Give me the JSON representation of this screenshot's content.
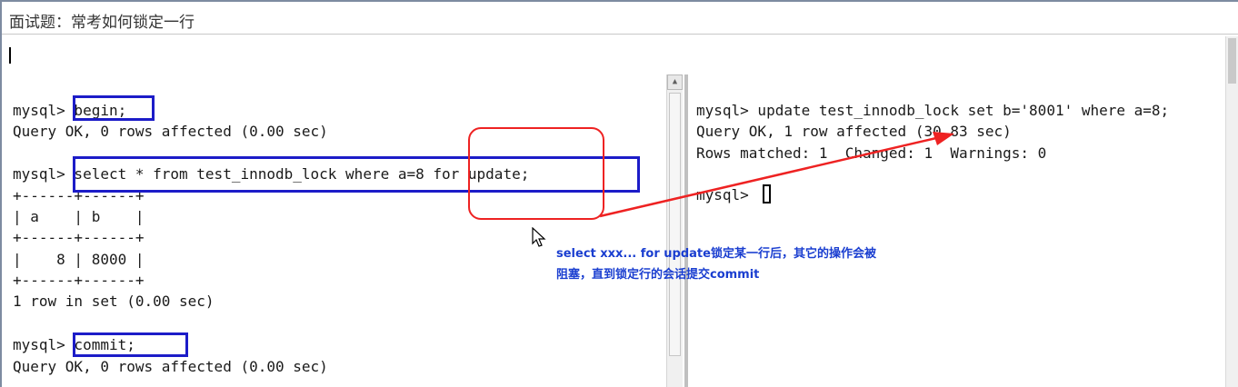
{
  "title": "面试题：常考如何锁定一行",
  "left_terminal": {
    "lines": [
      "mysql> begin;",
      "Query OK, 0 rows affected (0.00 sec)",
      "mysql> select * from test_innodb_lock where a=8 for update;",
      "+------+------+",
      "| a    | b    |",
      "+------+------+",
      "|    8 | 8000 |",
      "+------+------+",
      "1 row in set (0.00 sec)",
      "mysql> commit;",
      "Query OK, 0 rows affected (0.00 sec)"
    ]
  },
  "right_terminal": {
    "lines": [
      "mysql> update test_innodb_lock set b='8001' where a=8;",
      "Query OK, 1 row affected (30.83 sec)",
      "Rows matched: 1  Changed: 1  Warnings: 0",
      "mysql> "
    ]
  },
  "annotation": {
    "line1": "select xxx... for update锁定某一行后，其它的操作会被",
    "line2": "阻塞，直到锁定行的会话提交commit",
    "box_color": "#1c1cc8",
    "circle_color": "#ee2222",
    "arrow_color": "#ee2222",
    "text_color": "#1a3ed0"
  },
  "icons": {
    "scroll_up": "chevron-up-icon",
    "pointer": "mouse-pointer-icon"
  }
}
